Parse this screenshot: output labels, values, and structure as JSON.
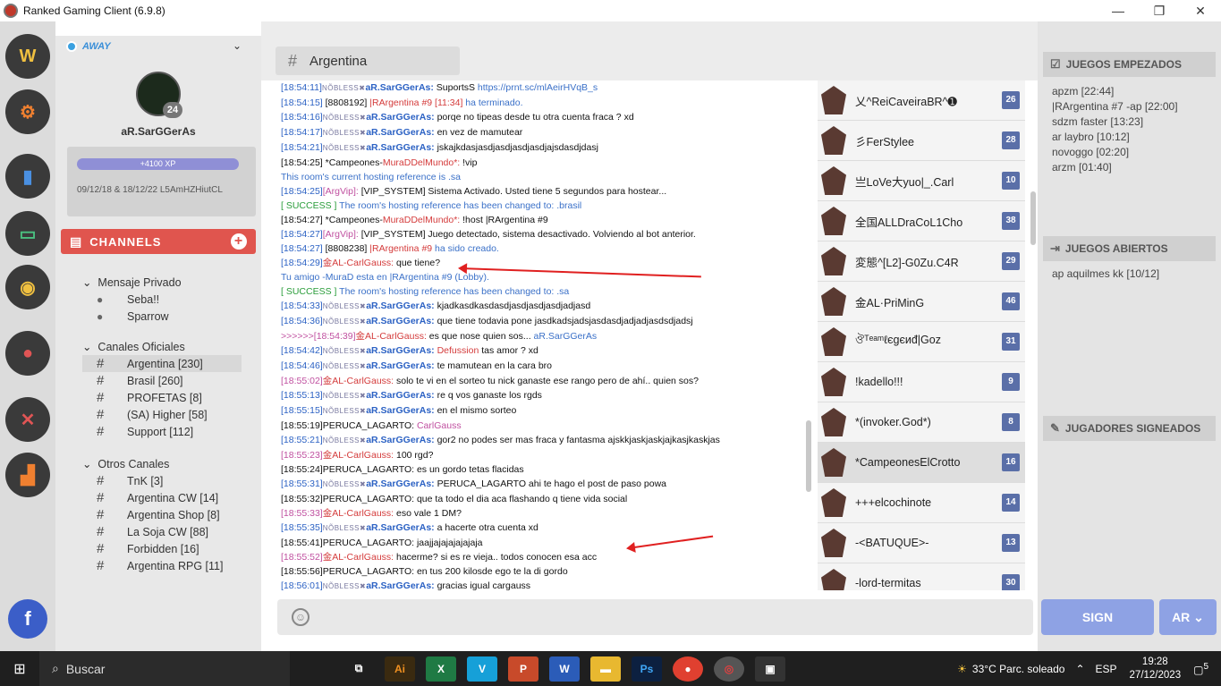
{
  "window": {
    "title": "Ranked Gaming Client (6.9.8)"
  },
  "rail": {
    "icons": [
      "wc3-icon",
      "settings-icon",
      "stats-icon",
      "console-icon",
      "coins-icon",
      "friends-icon",
      "swords-icon",
      "ranking-icon",
      "facebook-icon"
    ],
    "facebook_glyph": "f"
  },
  "profile": {
    "status": "AWAY",
    "level": "24",
    "username": "aR.SarGGerAs",
    "xp": "+4100 XP",
    "xp_fraction": 1.0,
    "note": "09/12/18 & 18/12/22 L5AmHZHiutCL"
  },
  "channels": {
    "title": "CHANNELS",
    "private_title": "Mensaje Privado",
    "private": [
      "Seba!!",
      "Sparrow"
    ],
    "official_title": "Canales Oficiales",
    "official": [
      "Argentina [230]",
      "Brasil [260]",
      "PROFETAS [8]",
      "(SA) Higher [58]",
      "Support [112]"
    ],
    "other_title": "Otros Canales",
    "other": [
      "TnK [3]",
      "Argentina CW [14]",
      "Argentina Shop [8]",
      "La Soja CW [88]",
      "Forbidden [16]",
      "Argentina RPG [11]"
    ]
  },
  "room": {
    "name": "Argentina"
  },
  "chat": [
    {
      "ts": "[18:54:11]",
      "pre": "NÕBLESS✖",
      "nick": "aR.SarGGerAs:",
      "nc": "nb",
      "msg": " SuportsS ",
      "link": "https://prnt.sc/mlAeirHVqB_s"
    },
    {
      "ts": "[18:54:15]",
      "plain": " [8808192] ",
      "nick": "|RArgentina #9 [11:34]",
      "nc": "nr",
      "msg": " ha terminado.",
      "mc": "sys"
    },
    {
      "ts": "[18:54:16]",
      "pre": "NÕBLESS✖",
      "nick": "aR.SarGGerAs:",
      "nc": "nb",
      "msg": " porqe no tipeas desde tu otra cuenta fraca ? xd"
    },
    {
      "ts": "[18:54:17]",
      "pre": "NÕBLESS✖",
      "nick": "aR.SarGGerAs:",
      "nc": "nb",
      "msg": " en vez de mamutear"
    },
    {
      "ts": "[18:54:21]",
      "pre": "NÕBLESS✖",
      "nick": "aR.SarGGerAs:",
      "nc": "nb",
      "msg": " jskajkdasjasdjasdjasdjasdjajsdasdjdasj"
    },
    {
      "ts": "[18:54:25]",
      "tsc": "tx",
      "plain": " *Campeones-",
      "nick": "MuraDDelMundo*:",
      "nc": "nr",
      "msg": " !vip"
    },
    {
      "sysline": "This room's current hosting reference is .sa"
    },
    {
      "ts": "[18:54:25]",
      "nick": "[ArgVip]:",
      "nc": "np",
      "msg": " [VIP_SYSTEM] Sistema Activado. Usted tiene 5 segundos para hostear..."
    },
    {
      "ts": "[ SUCCESS ]",
      "tsc": "ng",
      "msg": " The room's hosting reference has been changed to: ",
      "link": ".brasil",
      "mc": "sys"
    },
    {
      "ts": "[18:54:27]",
      "tsc": "tx",
      "plain": " *Campeones-",
      "nick": "MuraDDelMundo*:",
      "nc": "nr",
      "msg": " !host |RArgentina #9"
    },
    {
      "ts": "[18:54:27]",
      "nick": "[ArgVip]:",
      "nc": "np",
      "msg": " [VIP_SYSTEM] Juego detectado, sistema desactivado. Volviendo al bot anterior."
    },
    {
      "ts": "[18:54:27]",
      "plain": " [8808238] ",
      "nick": "|RArgentina #9",
      "nc": "nr",
      "msg": " ha sido creado.",
      "mc": "sys"
    },
    {
      "ts": "[18:54:29]",
      "nick": "金AL-CarlGauss:",
      "nc": "nr",
      "msg": " que tiene?"
    },
    {
      "sysline": "Tu amigo -MuraD esta en |RArgentina #9 (Lobby)."
    },
    {
      "ts": "[ SUCCESS ]",
      "tsc": "ng",
      "msg": " The room's hosting reference has been changed to: ",
      "link": ".sa",
      "mc": "sys"
    },
    {
      "ts": "[18:54:33]",
      "pre": "NÕBLESS✖",
      "nick": "aR.SarGGerAs:",
      "nc": "nb",
      "msg": " kjadkasdkasdasdjasdjasdjasdjadjasd"
    },
    {
      "ts": "[18:54:36]",
      "pre": "NÕBLESS✖",
      "nick": "aR.SarGGerAs:",
      "nc": "nb",
      "msg": " que tiene todavia pone jasdkadsjadsjasdasdjadjadjasdsdjadsj"
    },
    {
      "ts": ">>>>>>[18:54:39]",
      "tsc": "np",
      "nick": "金AL-CarlGauss:",
      "nc": "nr",
      "msg": " es que nose quien sos... ",
      "link": "aR.SarGGerAs"
    },
    {
      "ts": "[18:54:42]",
      "pre": "NÕBLESS✖",
      "nick": "aR.SarGGerAs:",
      "nc": "nb",
      "msg": " ",
      "red": "Defussion",
      "msg2": " tas amor ? xd"
    },
    {
      "ts": "[18:54:46]",
      "pre": "NÕBLESS✖",
      "nick": "aR.SarGGerAs:",
      "nc": "nb",
      "msg": " te mamutean en la cara bro"
    },
    {
      "ts": "[18:55:02]",
      "tsc": "np",
      "nick": "金AL-CarlGauss:",
      "nc": "nr",
      "msg": " solo te vi en el sorteo tu nick ganaste ese rango pero de ahí.. quien sos?"
    },
    {
      "ts": "[18:55:13]",
      "pre": "NÕBLESS✖",
      "nick": "aR.SarGGerAs:",
      "nc": "nb",
      "msg": " re q vos ganaste los rgds"
    },
    {
      "ts": "[18:55:15]",
      "pre": "NÕBLESS✖",
      "nick": "aR.SarGGerAs:",
      "nc": "nb",
      "msg": " en el mismo sorteo"
    },
    {
      "ts": "[18:55:19]",
      "tsc": "tx",
      "nick": "PERUCA_LAGARTO:",
      "nc": "tx",
      "msg": " ",
      "pink": "CarlGauss"
    },
    {
      "ts": "[18:55:21]",
      "pre": "NÕBLESS✖",
      "nick": "aR.SarGGerAs:",
      "nc": "nb",
      "msg": " gor2 no podes ser mas fraca y fantasma ajskkjaskjaskjajkasjkaskjas"
    },
    {
      "ts": "[18:55:23]",
      "tsc": "np",
      "nick": "金AL-CarlGauss:",
      "nc": "nr",
      "msg": " 100 rgd?"
    },
    {
      "ts": "[18:55:24]",
      "tsc": "tx",
      "nick": "PERUCA_LAGARTO:",
      "nc": "tx",
      "msg": " es un gordo tetas flacidas"
    },
    {
      "ts": "[18:55:31]",
      "pre": "NÕBLESS✖",
      "nick": "aR.SarGGerAs:",
      "nc": "nb",
      "msg": " PERUCA_LAGARTO ahi te hago el post de paso powa"
    },
    {
      "ts": "[18:55:32]",
      "tsc": "tx",
      "nick": "PERUCA_LAGARTO:",
      "nc": "tx",
      "msg": " que ta todo el dia aca flashando q tiene vida social"
    },
    {
      "ts": "[18:55:33]",
      "tsc": "np",
      "nick": "金AL-CarlGauss:",
      "nc": "nr",
      "msg": " eso vale 1 DM?"
    },
    {
      "ts": "[18:55:35]",
      "pre": "NÕBLESS✖",
      "nick": "aR.SarGGerAs:",
      "nc": "nb",
      "msg": " a hacerte otra cuenta xd"
    },
    {
      "ts": "[18:55:41]",
      "tsc": "tx",
      "nick": "PERUCA_LAGARTO:",
      "nc": "tx",
      "msg": " jaajjajajajajajaja"
    },
    {
      "ts": "[18:55:52]",
      "tsc": "np",
      "nick": "金AL-CarlGauss:",
      "nc": "nr",
      "msg": " hacerme? si es re vieja.. todos conocen esa acc"
    },
    {
      "ts": "[18:55:56]",
      "tsc": "tx",
      "nick": "PERUCA_LAGARTO:",
      "nc": "tx",
      "msg": " en tus 200 kilosde ego te la di gordo"
    },
    {
      "ts": "[18:56:01]",
      "pre": "NÕBLESS✖",
      "nick": "aR.SarGGerAs:",
      "nc": "nb",
      "msg": " gracias igual cargauss"
    }
  ],
  "users": [
    {
      "name": "乂^ReiCaveiraBR^➊",
      "level": "26"
    },
    {
      "name": "彡FerStylee",
      "level": "28"
    },
    {
      "name": "亗LoVe大yuo|_.Carl",
      "level": "10"
    },
    {
      "name": "全国ALLDraCoL1Cho",
      "level": "38"
    },
    {
      "name": "変態^[L2]-G0Zu.C4R",
      "level": "29"
    },
    {
      "name": "金AL·PriMinG",
      "level": "46"
    },
    {
      "name": "ঔᵀᵉᵃᵐℓєgєиđ|Goz",
      "level": "31"
    },
    {
      "name": "!kadello!!!",
      "level": "9"
    },
    {
      "name": "*(invoker.God*)",
      "level": "8"
    },
    {
      "name": "*CampeonesElCrotto",
      "level": "16"
    },
    {
      "name": "+++elcochinote",
      "level": "14"
    },
    {
      "name": "-<BATUQUE>-",
      "level": "13"
    },
    {
      "name": "-lord-termitas",
      "level": "30"
    }
  ],
  "games_started": {
    "title": "JUEGOS EMPEZADOS",
    "items": [
      "apzm [22:44]",
      "|RArgentina #7 -ap [22:00]",
      "sdzm faster [13:23]",
      "ar laybro [10:12]",
      "novoggo [02:20]",
      "arzm [01:40]"
    ]
  },
  "games_open": {
    "title": "JUEGOS ABIERTOS",
    "items": [
      "ap aquilmes kk [10/12]"
    ]
  },
  "signed_players": {
    "title": "JUGADORES SIGNEADOS"
  },
  "buttons": {
    "sign": "SIGN",
    "lang": "AR"
  },
  "taskbar": {
    "search": "Buscar",
    "weather": "33°C  Parc. soleado",
    "lang": "ESP",
    "time": "19:28",
    "date": "27/12/2023",
    "notif": "5"
  }
}
